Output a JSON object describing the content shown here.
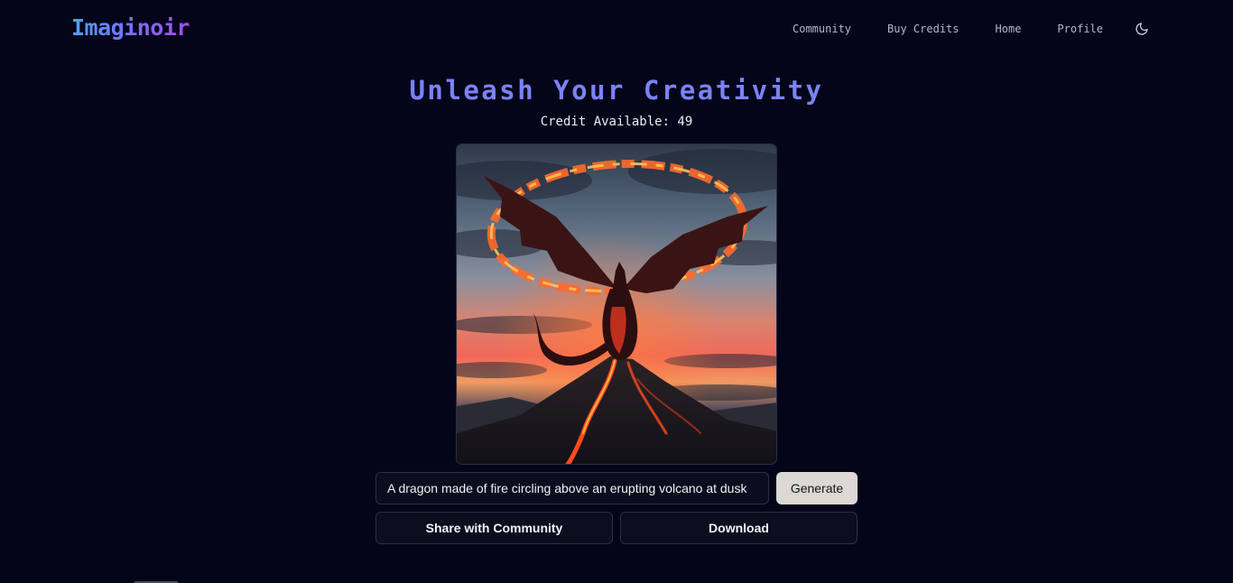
{
  "header": {
    "logo": "Imaginoir",
    "nav": [
      {
        "label": "Community"
      },
      {
        "label": "Buy Credits"
      },
      {
        "label": "Home"
      },
      {
        "label": "Profile"
      }
    ],
    "theme_icon": "moon-icon"
  },
  "main": {
    "title": "Unleash Your Creativity",
    "credits": "Credit Available: 49",
    "image_subject": "generated-dragon-image",
    "prompt": {
      "value": "A dragon made of fire circling above an erupting volcano at dusk",
      "placeholder": ""
    },
    "generate_label": "Generate",
    "share_label": "Share with Community",
    "download_label": "Download"
  },
  "colors": {
    "background": "#05051a",
    "accent": "#7b82f5",
    "logo_gradient_start": "#4fa0ff",
    "logo_gradient_end": "#a24ff0",
    "generate_button": "#dcd8d4"
  }
}
